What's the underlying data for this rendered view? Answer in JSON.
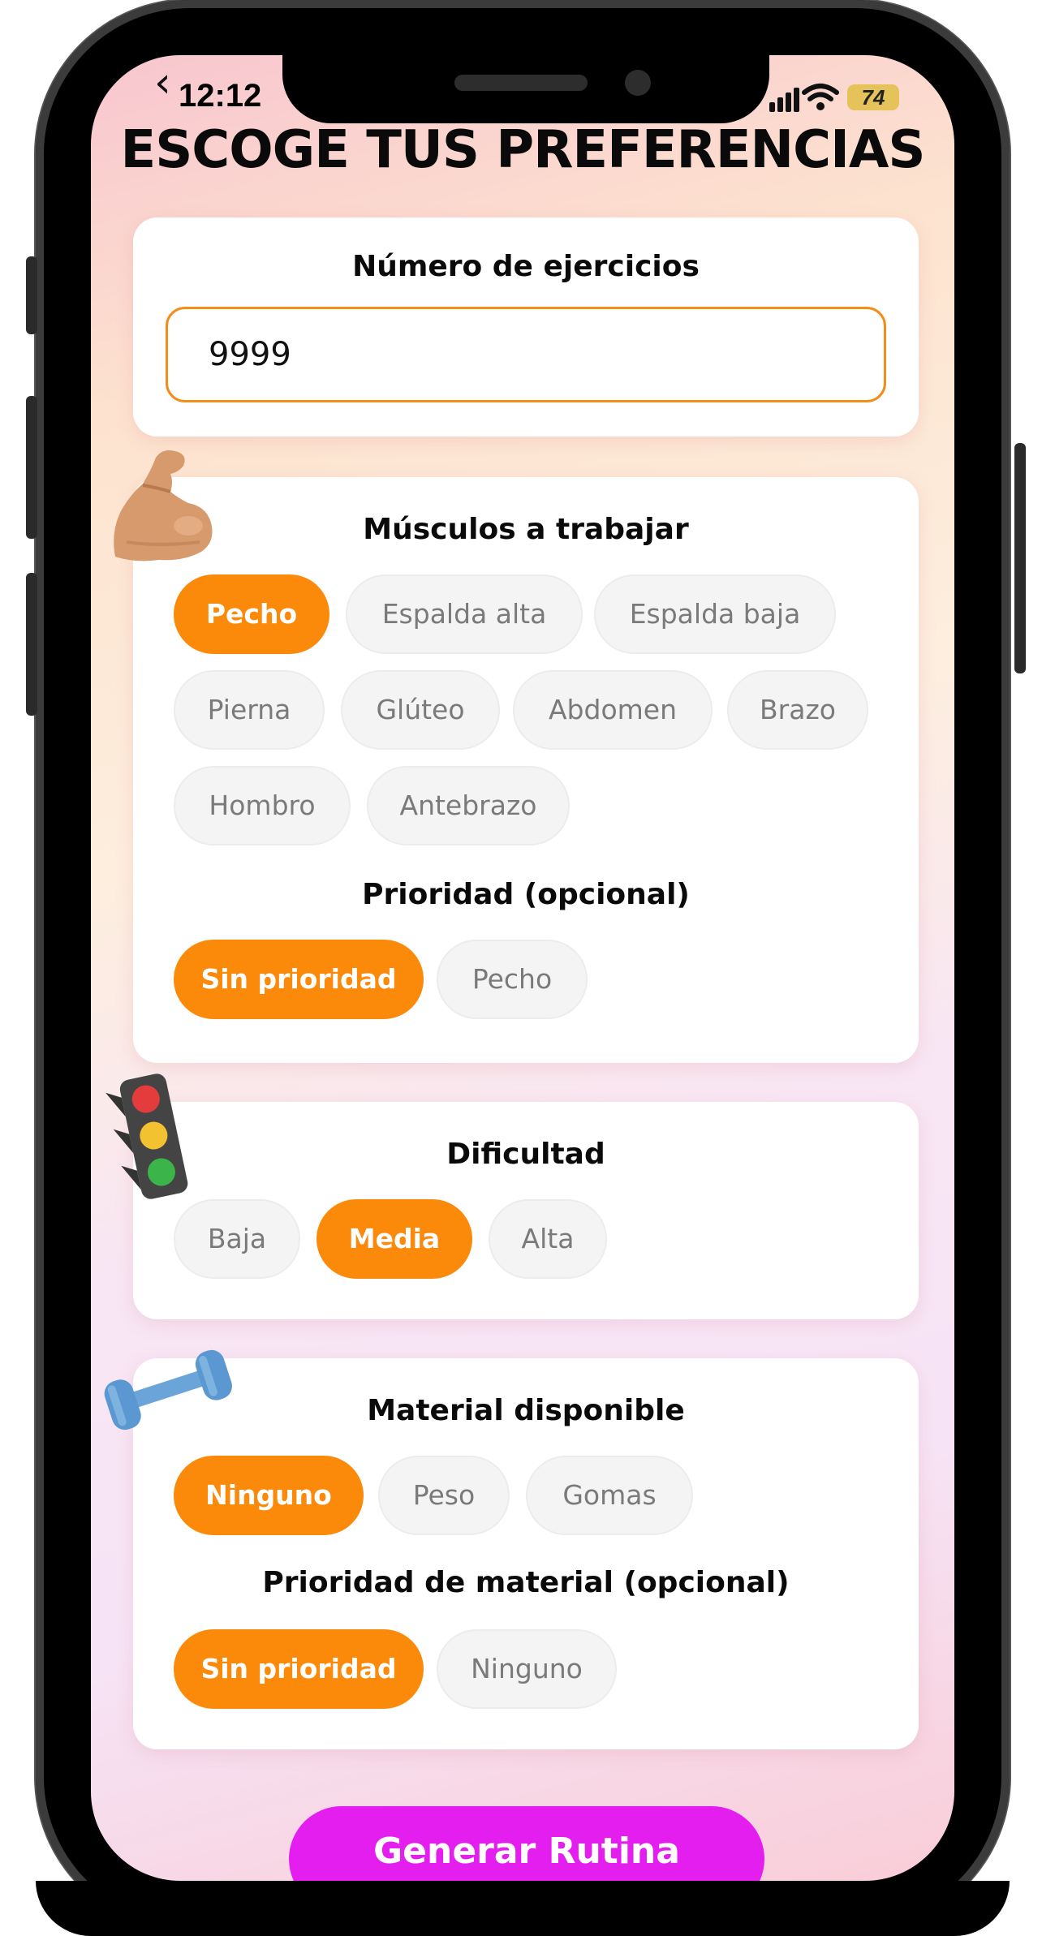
{
  "status_bar": {
    "time": "12:12",
    "battery": "74"
  },
  "header": {
    "title": "ESCOGE TUS PREFERENCIAS"
  },
  "exercises_card": {
    "heading": "Número de ejercicios",
    "value": "9999"
  },
  "muscles_card": {
    "heading": "Músculos a trabajar",
    "chips": [
      {
        "label": "Pecho",
        "selected": true
      },
      {
        "label": "Espalda alta",
        "selected": false
      },
      {
        "label": "Espalda baja",
        "selected": false
      },
      {
        "label": "Pierna",
        "selected": false
      },
      {
        "label": "Glúteo",
        "selected": false
      },
      {
        "label": "Abdomen",
        "selected": false
      },
      {
        "label": "Brazo",
        "selected": false
      },
      {
        "label": "Hombro",
        "selected": false
      },
      {
        "label": "Antebrazo",
        "selected": false
      }
    ],
    "priority_heading": "Prioridad (opcional)",
    "priority_chips": [
      {
        "label": "Sin prioridad",
        "selected": true
      },
      {
        "label": "Pecho",
        "selected": false
      }
    ]
  },
  "difficulty_card": {
    "heading": "Dificultad",
    "chips": [
      {
        "label": "Baja",
        "selected": false
      },
      {
        "label": "Media",
        "selected": true
      },
      {
        "label": "Alta",
        "selected": false
      }
    ]
  },
  "material_card": {
    "heading": "Material disponible",
    "chips": [
      {
        "label": "Ninguno",
        "selected": true
      },
      {
        "label": "Peso",
        "selected": false
      },
      {
        "label": "Gomas",
        "selected": false
      }
    ],
    "priority_heading": "Prioridad de material (opcional)",
    "priority_chips": [
      {
        "label": "Sin prioridad",
        "selected": true
      },
      {
        "label": "Ninguno",
        "selected": false
      }
    ]
  },
  "footer": {
    "generate_label": "Generar Rutina"
  },
  "colors": {
    "accent": "#fb8a0a",
    "generate": "#e51ef0",
    "input_border": "#f28c1a"
  }
}
